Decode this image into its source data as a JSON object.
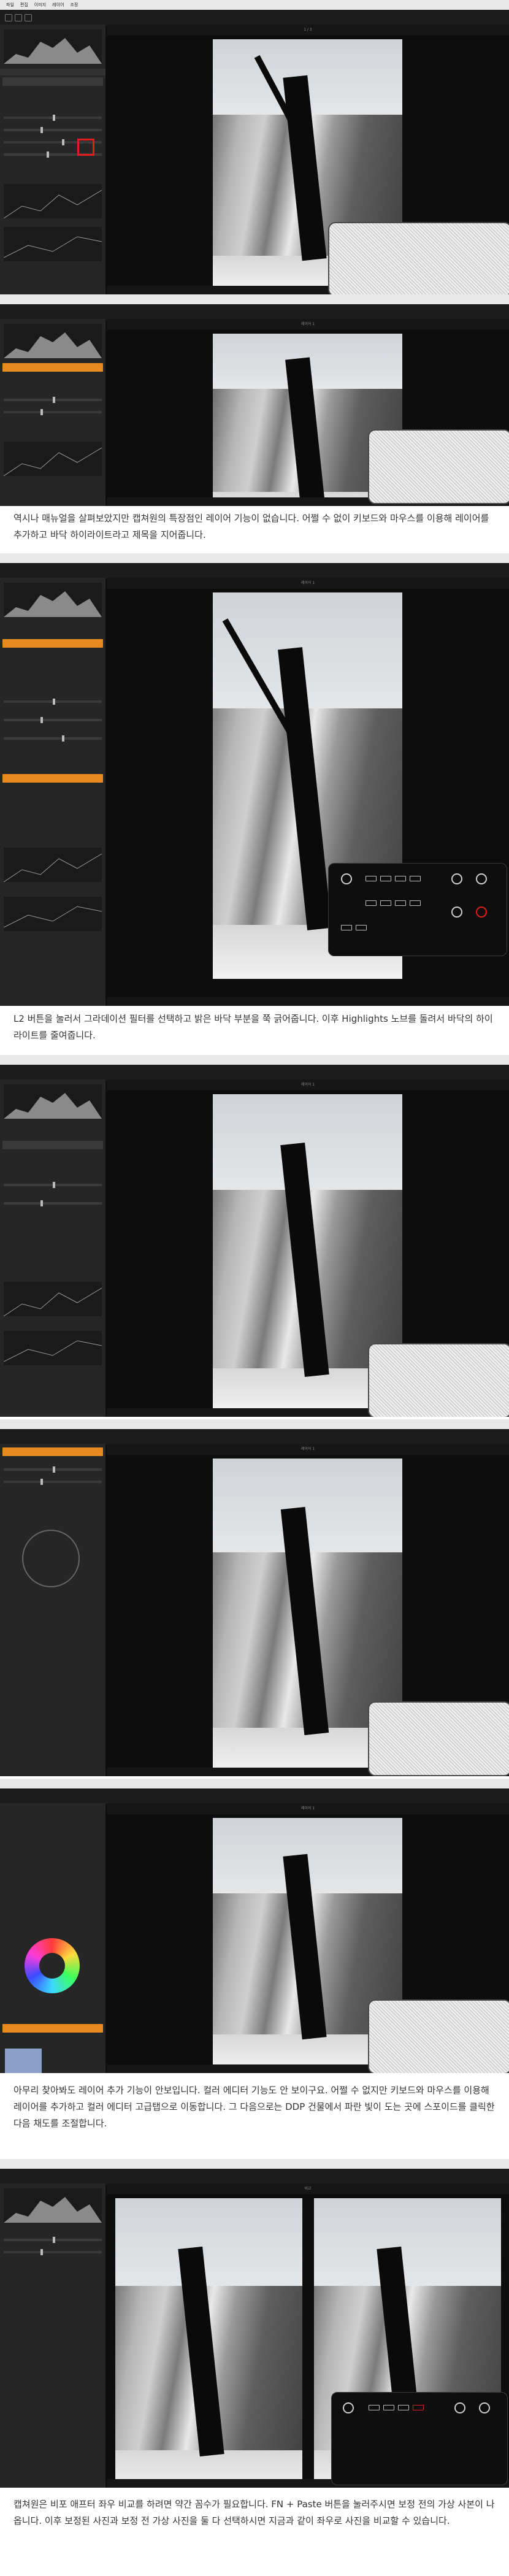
{
  "menu_items": [
    "파일",
    "편집",
    "이미지",
    "레이어",
    "조정",
    "주석",
    "선택",
    "보기",
    "창",
    "도움말"
  ],
  "viewer_tabs": [
    "1 / 3",
    "레이어 1",
    "비교"
  ],
  "captions": [
    "역시나 매뉴얼을 살펴보았지만 캡쳐원의 특장점인 레이어 기능이 없습니다. 어쩔 수 없이 키보드와 마우스를 이용해 레이어를 추가하고 바닥 하이라이트라고 제목을 지어줍니다.",
    "L2 버튼을 눌러서 그라데이션 필터를 선택하고 밝은 바닥 부분을 쭉 긁어줍니다. 이후 Highlights 노브를 돌려서 바닥의 하이라이트를 줄여줍니다.",
    "아무리 찾아봐도 레이어 추가 기능이 안보입니다. 컬러 에디터 기능도 안 보이구요. 어쩔 수 없지만 키보드와 마우스를 이용해 레이어를 추가하고 컬러 에디터 고급탭으로 이동합니다. 그 다음으로는 DDP 건물에서 파란 빛이 도는 곳에 스포이드를 클릭한 다음 채도를 조절합니다.",
    "캡쳐원은 비포 애프터 좌우 비교를 하려면 약간 꼼수가 필요합니다. FN + Paste 버튼을 눌러주시면 보정 전의 가상 사본이 나옵니다. 이후 보정된 사진과 보정 전 가상 사진을 둘 다 선택하시면 지금과 같이 좌우로 사진을 비교할 수 있습니다."
  ],
  "colors": {
    "accent_orange": "#e8891e",
    "highlight_red": "#e21d1d",
    "panel_bg": "#262626"
  }
}
